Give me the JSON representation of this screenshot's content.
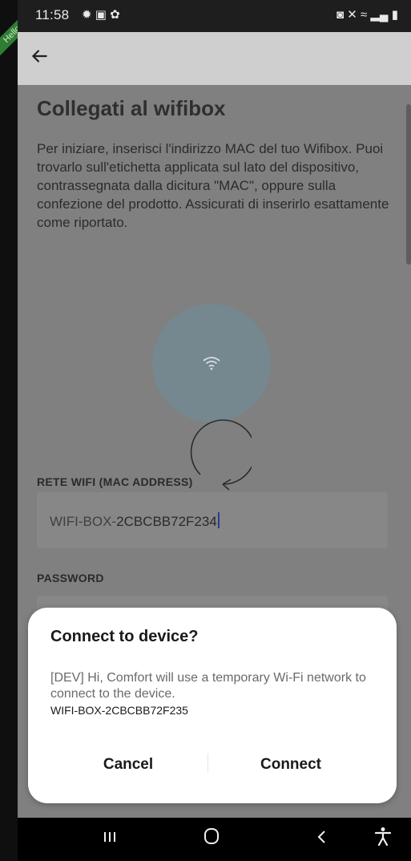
{
  "status_bar": {
    "time": "11:58",
    "left_icons": [
      "brightness-icon",
      "image-icon",
      "settings-icon"
    ],
    "right_icons": [
      "vibrate-icon",
      "mute-icon",
      "wifi-icon",
      "signal-icon",
      "battery-icon"
    ]
  },
  "debug_ribbon": "Hello Stev",
  "page": {
    "title": "Collegati al wifibox",
    "description": "Per iniziare, inserisci l'indirizzo MAC del tuo Wifibox. Puoi trovarlo sull'etichetta applicata sul lato del dispositivo, contrassegnata dalla dicitura \"MAC\", oppure sulla confezione del prodotto. Assicurati di inserirlo esattamente come riportato.",
    "wifi_label": "RETE WIFI (MAC ADDRESS)",
    "mac_prefix": "WIFI-BOX-",
    "mac_value": "2CBCBB72F234",
    "password_label": "PASSWORD"
  },
  "dialog": {
    "title": "Connect to device?",
    "message": "[DEV] Hi, Comfort will use a temporary Wi-Fi network to connect to the device.",
    "ssid": "WIFI-BOX-2CBCBB72F235",
    "cancel": "Cancel",
    "connect": "Connect"
  },
  "colors": {
    "wifi_circle": "#75878f",
    "caret": "#2f3a8a"
  }
}
